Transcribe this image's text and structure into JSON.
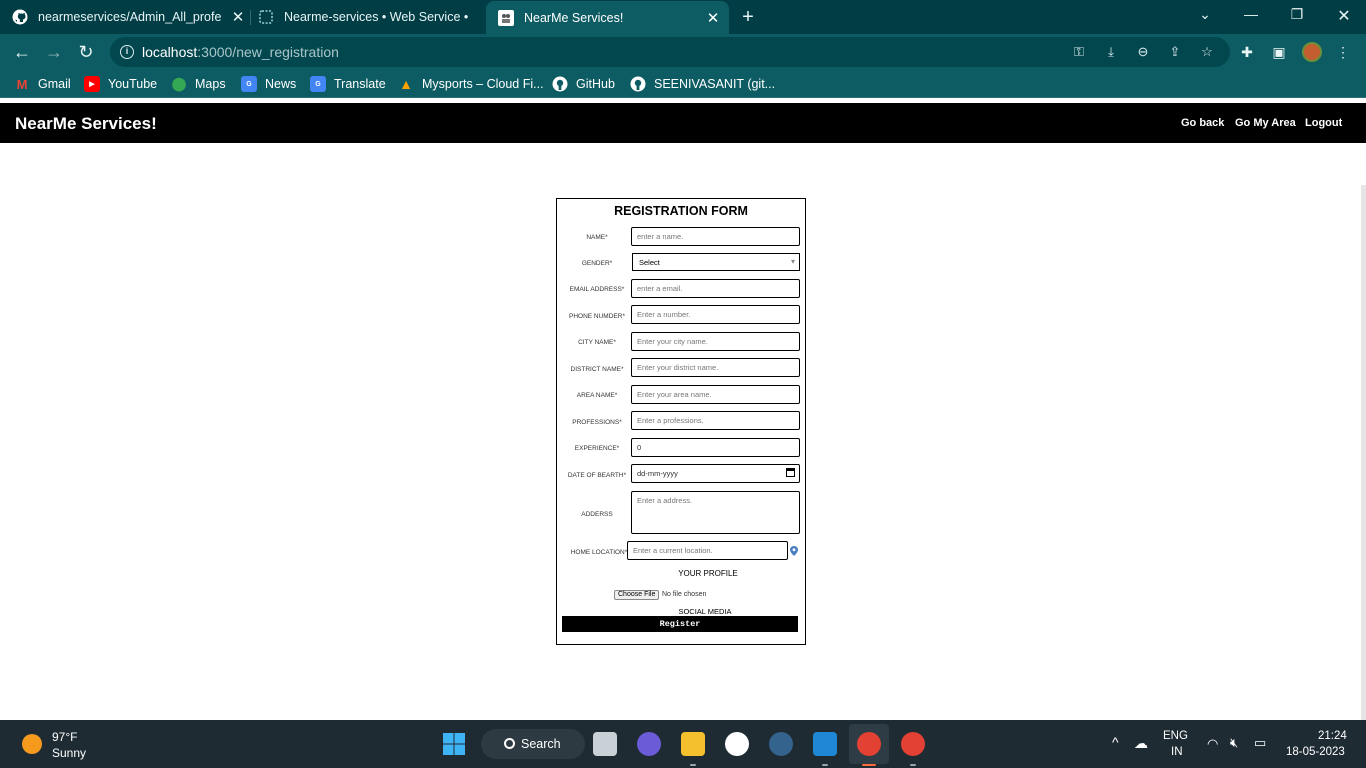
{
  "browser": {
    "tabs": [
      {
        "title": "nearmeservices/Admin_All_profe",
        "icon": "github-icon",
        "active": false
      },
      {
        "title": "Nearme-services • Web Service •",
        "icon": "render-icon",
        "active": false
      },
      {
        "title": "NearMe Services!",
        "icon": "nearme-favicon",
        "active": true
      }
    ],
    "url_host": "localhost",
    "url_path": ":3000/new_registration",
    "bookmarks": [
      {
        "label": "Gmail",
        "icon": "gmail-icon"
      },
      {
        "label": "YouTube",
        "icon": "youtube-icon"
      },
      {
        "label": "Maps",
        "icon": "maps-icon"
      },
      {
        "label": "News",
        "icon": "news-icon"
      },
      {
        "label": "Translate",
        "icon": "translate-icon"
      },
      {
        "label": "Mysports – Cloud Fi...",
        "icon": "firebase-icon"
      },
      {
        "label": "GitHub",
        "icon": "github-icon"
      },
      {
        "label": "SEENIVASANIT (git...",
        "icon": "github-icon"
      }
    ]
  },
  "app": {
    "brand": "NearMe Services!",
    "nav": [
      "Go back",
      "Go My Area",
      "Logout"
    ]
  },
  "form": {
    "title": "REGISTRATION FORM",
    "fields": {
      "name": {
        "label": "NAME*",
        "placeholder": "enter a name."
      },
      "gender": {
        "label": "GENDER*",
        "value": "Select"
      },
      "email": {
        "label": "EMAIL ADDRESS*",
        "placeholder": "enter a email."
      },
      "phone": {
        "label": "PHONE NUMDER*",
        "placeholder": "Enter a number."
      },
      "city": {
        "label": "CITY NAME*",
        "placeholder": "Enter your city name."
      },
      "district": {
        "label": "DISTRICT NAME*",
        "placeholder": "Enter your district name."
      },
      "area": {
        "label": "AREA NAME*",
        "placeholder": "Enter your area name."
      },
      "profession": {
        "label": "PROFESSIONS*",
        "placeholder": "Enter a professions."
      },
      "experience": {
        "label": "EXPERIENCE*",
        "value": "0"
      },
      "dob": {
        "label": "DATE OF BEARTH*",
        "value": "dd-mm-yyyy"
      },
      "address": {
        "label": "ADDERSS",
        "placeholder": "Enter a address."
      },
      "location": {
        "label": "HOME LOCATION*",
        "placeholder": "Enter a current location."
      }
    },
    "profile_label": "YOUR PROFILE",
    "file_button": "Choose File",
    "file_status": "No file chosen",
    "social_label": "SOCIAL MEDIA",
    "submit": "Register"
  },
  "taskbar": {
    "weather_temp": "97°F",
    "weather_cond": "Sunny",
    "search": "Search",
    "lang": "ENG",
    "region": "IN",
    "time": "21:24",
    "date": "18-05-2023"
  }
}
